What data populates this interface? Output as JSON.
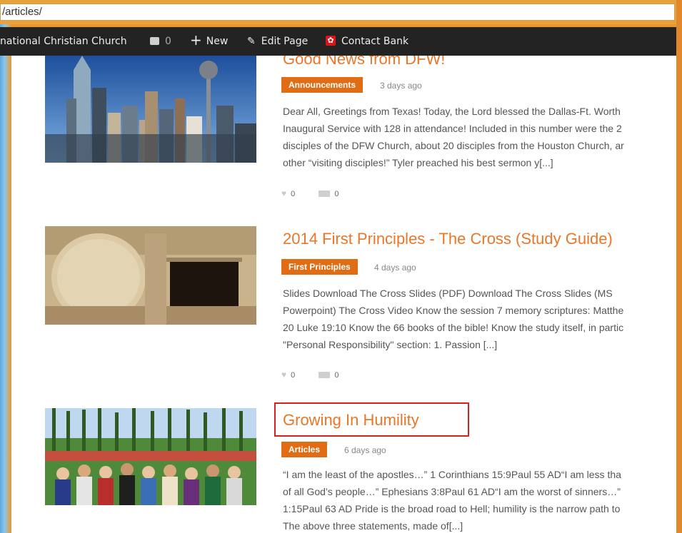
{
  "browser": {
    "url": "/articles/"
  },
  "admin_bar": {
    "site_name": "national Christian Church",
    "comments_count": "0",
    "new_label": "New",
    "edit_label": "Edit Page",
    "contact_label": "Contact Bank",
    "contact_icon_glyph": "✿"
  },
  "posts": [
    {
      "title": "Good News from DFW!",
      "category": "Announcements",
      "date": "3 days ago",
      "excerpt": [
        "Dear All, Greetings from Texas! Today, the Lord blessed the Dallas-Ft. Worth",
        "Inaugural Service with 128 in attendance! Included in this number were the 2",
        "disciples of the DFW Church, about 20 disciples from the Houston Church, ar",
        "other “visiting disciples!” Tyler preached his best sermon y[...]"
      ],
      "likes": "0",
      "comments": "0"
    },
    {
      "title": "2014 First Principles - The Cross (Study Guide)",
      "category": "First Principles",
      "date": "4 days ago",
      "excerpt": [
        "Slides Download The Cross Slides (PDF) Download The Cross Slides (MS",
        "Powerpoint) The Cross Video Know the session 7 memory scriptures: Matthe",
        "20 Luke 19:10 Know the 66 books of the bible! Know the study itself, in partic",
        "\"Personal Responsibility\" section: 1. Passion [...]"
      ],
      "likes": "0",
      "comments": "0"
    },
    {
      "title": "Growing In Humility",
      "category": "Articles",
      "date": "6 days ago",
      "excerpt": [
        "“I am the least of the apostles…” 1 Corinthians 15:9Paul 55 AD“I am less tha",
        "of all God’s people…” Ephesians 3:8Paul 61 AD“I am the worst of sinners…”",
        "1:15Paul 63 AD Pride is the broad road to Hell; humility is the narrow path to",
        "The above three statements, made of[...]"
      ]
    }
  ]
}
